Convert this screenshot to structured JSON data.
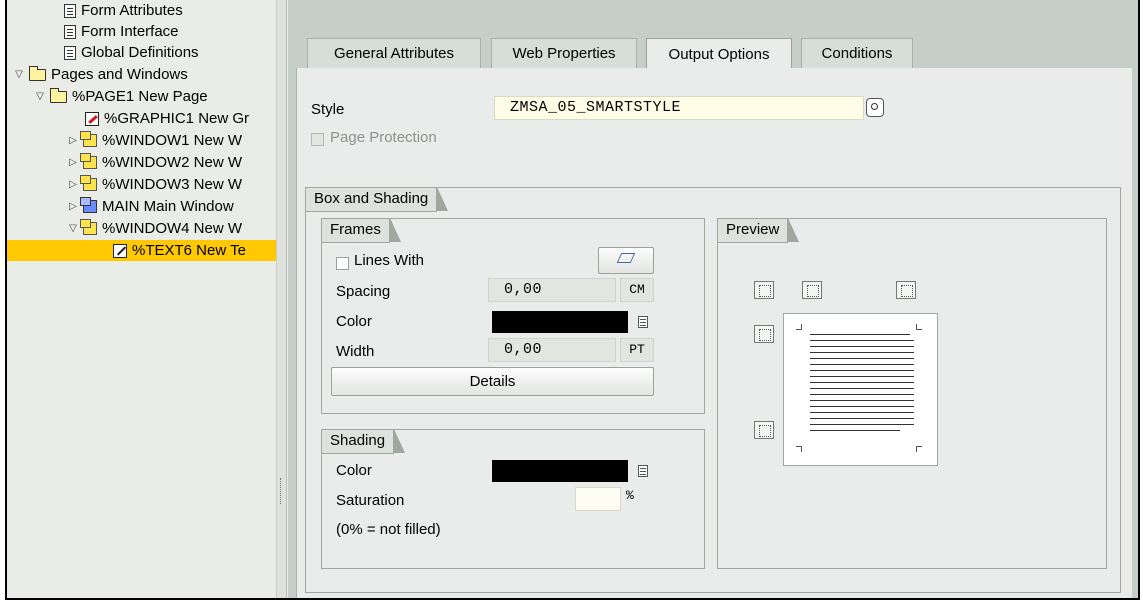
{
  "tree": {
    "items": [
      {
        "label": "Form Attributes",
        "icon": "document-icon"
      },
      {
        "label": "Form Interface",
        "icon": "document-icon"
      },
      {
        "label": "Global Definitions",
        "icon": "document-icon"
      },
      {
        "label": "Pages and Windows",
        "icon": "folder-icon"
      },
      {
        "label": "%PAGE1 New Page",
        "icon": "folder-icon"
      },
      {
        "label": "%GRAPHIC1 New Gr",
        "icon": "graphic-icon"
      },
      {
        "label": "%WINDOW1 New W",
        "icon": "window-icon"
      },
      {
        "label": "%WINDOW2 New W",
        "icon": "window-icon"
      },
      {
        "label": "%WINDOW3 New W",
        "icon": "window-icon"
      },
      {
        "label": "MAIN Main Window",
        "icon": "main-window-icon"
      },
      {
        "label": "%WINDOW4 New W",
        "icon": "window-icon"
      },
      {
        "label": "%TEXT6 New Te",
        "icon": "text-icon"
      }
    ]
  },
  "tabs": [
    {
      "label": "General Attributes"
    },
    {
      "label": "Web Properties"
    },
    {
      "label": "Output Options"
    },
    {
      "label": "Conditions"
    }
  ],
  "form": {
    "style_label": "Style",
    "style_value": "ZMSA_05_SMARTSTYLE",
    "page_protection_label": "Page Protection"
  },
  "box_shading": {
    "title": "Box and Shading",
    "frames": {
      "title": "Frames",
      "lines_with_label": "Lines With",
      "spacing_label": "Spacing",
      "spacing_value": "0,00",
      "spacing_unit": "CM",
      "color_label": "Color",
      "color_value": "#000000",
      "width_label": "Width",
      "width_value": "0,00",
      "width_unit": "PT",
      "details_button": "Details"
    },
    "shading": {
      "title": "Shading",
      "color_label": "Color",
      "color_value": "#000000",
      "saturation_label": "Saturation",
      "saturation_value": "",
      "saturation_unit": "%",
      "note": "(0% = not filled)"
    },
    "preview": {
      "title": "Preview"
    }
  },
  "colors": {
    "selection": "#ffc800",
    "field_bg": "#fffde6",
    "tab_area": "#c6cec9"
  }
}
